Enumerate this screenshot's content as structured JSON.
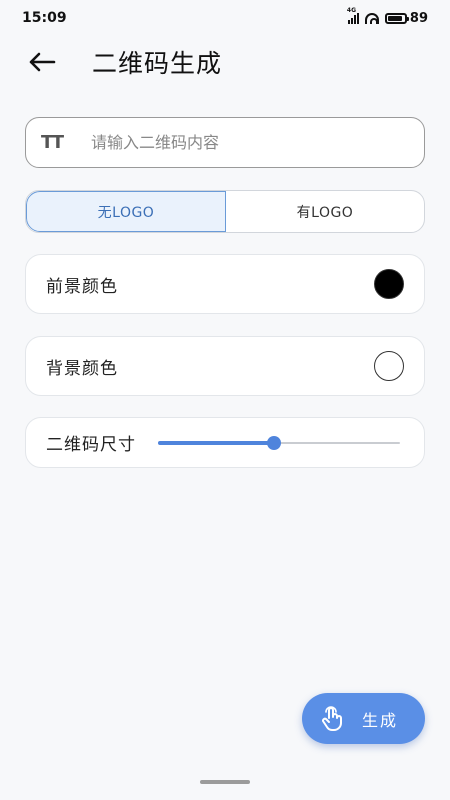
{
  "status_bar": {
    "time": "15:09",
    "network": "4G",
    "battery_level": "89"
  },
  "header": {
    "title": "二维码生成"
  },
  "content_input": {
    "placeholder": "请输入二维码内容",
    "value": ""
  },
  "logo_toggle": {
    "options": [
      "无LOGO",
      "有LOGO"
    ],
    "selected": "无LOGO"
  },
  "foreground": {
    "label": "前景颜色",
    "color": "#000000"
  },
  "background": {
    "label": "背景颜色",
    "color": "#ffffff"
  },
  "size": {
    "label": "二维码尺寸",
    "value_fraction": 0.48
  },
  "fab": {
    "label": "生成"
  },
  "colors": {
    "accent": "#5a8fe6",
    "segment_active_bg": "#eaf2fc",
    "segment_active_text": "#3b6fb6"
  },
  "icons": {
    "back": "arrow-left-icon",
    "text_size": "text-fields-icon",
    "fab": "touch-hand-icon"
  }
}
